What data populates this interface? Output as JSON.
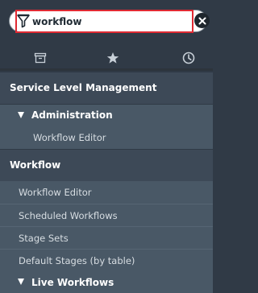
{
  "search": {
    "value": "workflow"
  },
  "tabs": [
    {
      "name": "archive-icon"
    },
    {
      "name": "star-icon"
    },
    {
      "name": "clock-icon"
    }
  ],
  "sections": {
    "slm": {
      "label": "Service Level Management"
    },
    "administration": {
      "label": "Administration"
    },
    "workflow_editor_1": {
      "label": "Workflow Editor"
    },
    "workflow": {
      "label": "Workflow"
    },
    "workflow_items": [
      "Workflow Editor",
      "Scheduled Workflows",
      "Stage Sets",
      "Default Stages (by table)"
    ],
    "live_workflows": {
      "label": "Live Workflows"
    }
  },
  "colors": {
    "highlight": "#e02a33",
    "panel_bg": "#303a46",
    "section_bg": "#3d4957",
    "item_bg": "#495866"
  }
}
